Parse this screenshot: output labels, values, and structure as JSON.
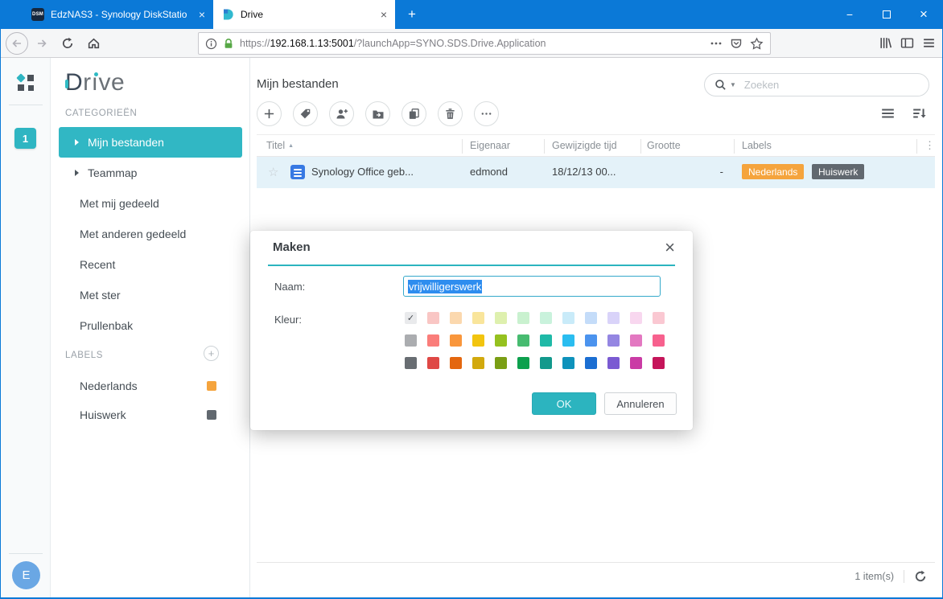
{
  "browser": {
    "tab1": {
      "title": "EdzNAS3 - Synology DiskStatio",
      "favicon_text": "DSM",
      "close": "×"
    },
    "tab2": {
      "title": "Drive",
      "close": "×"
    },
    "new_tab": "+",
    "window_controls": {
      "minimize": "−",
      "close": "×"
    },
    "url": {
      "scheme": "https://",
      "host": "192.168.1.13:5001",
      "path": "/?launchApp=SYNO.SDS.Drive.Application"
    }
  },
  "rail": {
    "badge": "1",
    "avatar": "E"
  },
  "sidebar": {
    "logo": {
      "part_d": "D",
      "part_r": "r",
      "part_i": "ı",
      "part_ve": "ve"
    },
    "categories_header": "CATEGORIEËN",
    "items": [
      {
        "label": "Mijn bestanden",
        "selected": true
      },
      {
        "label": "Teammap",
        "selected": false
      },
      {
        "label": "Met mij gedeeld",
        "selected": false
      },
      {
        "label": "Met anderen gedeeld",
        "selected": false
      },
      {
        "label": "Recent",
        "selected": false
      },
      {
        "label": "Met ster",
        "selected": false
      },
      {
        "label": "Prullenbak",
        "selected": false
      }
    ],
    "labels_header": "LABELS",
    "labels": [
      {
        "name": "Nederlands",
        "color": "#f5a43d"
      },
      {
        "name": "Huiswerk",
        "color": "#61686f"
      }
    ]
  },
  "main": {
    "title": "Mijn bestanden",
    "search_placeholder": "Zoeken",
    "table": {
      "columns": [
        "Titel",
        "Eigenaar",
        "Gewijzigde tijd",
        "Grootte",
        "Labels"
      ],
      "row": {
        "title": "Synology Office geb...",
        "owner": "edmond",
        "modified": "18/12/13 00...",
        "size": "-",
        "labels": [
          {
            "text": "Nederlands",
            "color": "#f5a43d"
          },
          {
            "text": "Huiswerk",
            "color": "#61686f"
          }
        ]
      }
    },
    "status": "1 item(s)"
  },
  "modal": {
    "title": "Maken",
    "close": "×",
    "name_label": "Naam:",
    "name_value": "vrijwilligerswerk",
    "color_label": "Kleur:",
    "ok": "OK",
    "cancel": "Annuleren",
    "selected_swatch": [
      0,
      0
    ],
    "colors": [
      [
        "#e9eaec",
        "#f9c6c4",
        "#fbd8ae",
        "#f9e59b",
        "#def0ae",
        "#c9f1cf",
        "#c9f2dc",
        "#c9ebf9",
        "#c4dcf9",
        "#d9d3f9",
        "#f8d7ef",
        "#fac8d2"
      ],
      [
        "#abadb0",
        "#fa7d7a",
        "#f9963c",
        "#f2c40f",
        "#95c11f",
        "#47bb70",
        "#1fb9a7",
        "#2abdf0",
        "#4b93ee",
        "#9486e2",
        "#e378c1",
        "#f7618e"
      ],
      [
        "#686d72",
        "#df4845",
        "#e4670f",
        "#d2a90d",
        "#7a9e14",
        "#0da04d",
        "#12998c",
        "#0e92bb",
        "#1b6ed2",
        "#7a5ad2",
        "#ca3ba5",
        "#c5155a"
      ]
    ],
    "accent_color": "#2cb4bf",
    "titlebar_color": "#0b79d7"
  }
}
